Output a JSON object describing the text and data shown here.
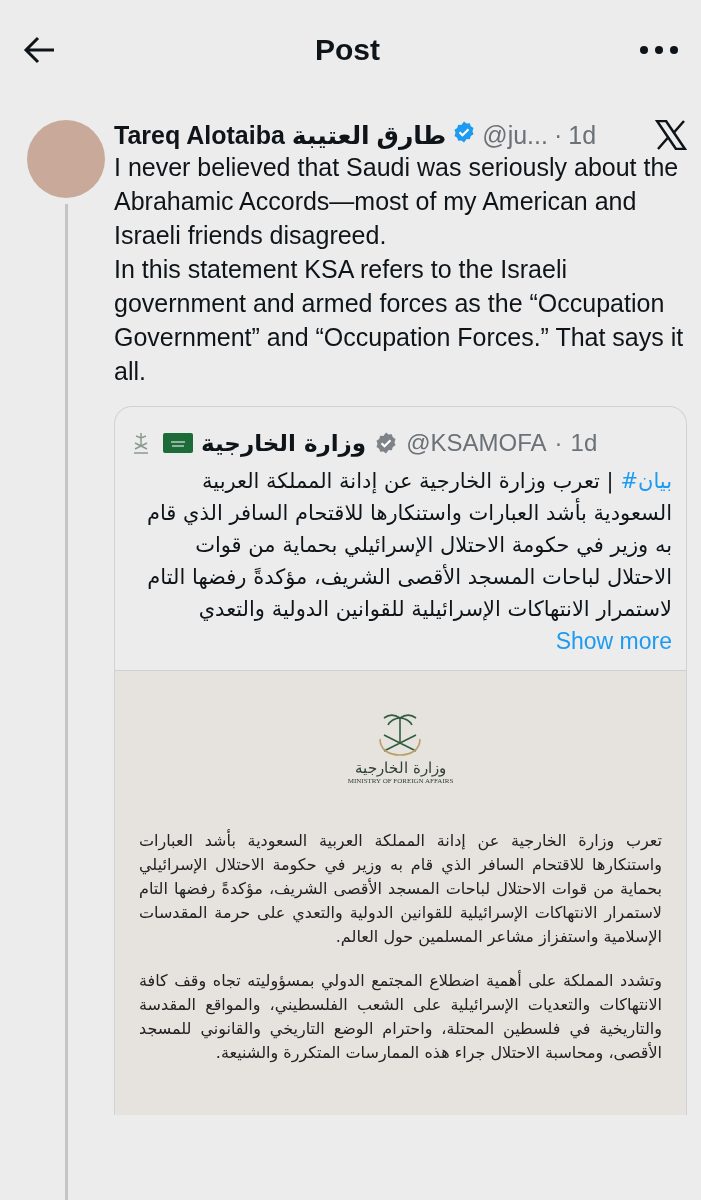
{
  "header": {
    "title": "Post"
  },
  "post": {
    "author_name": "Tareq Alotaiba طارق العتيبة",
    "verified": true,
    "handle": "@ju...",
    "separator": "·",
    "time": "1d",
    "paragraphs": [
      "I never believed that Saudi was seriously about the Abrahamic Accords—most of my American and Israeli friends disagreed.",
      "In this statement KSA refers to the Israeli government and armed forces as the “Occupation Government” and “Occupation Forces.” That says it all."
    ]
  },
  "quote": {
    "author_name": "وزارة الخارجية",
    "verified": true,
    "handle": "@KSAMOFA",
    "separator": "·",
    "time": "1d",
    "hashtag": "#بيان",
    "text": " | تعرب وزارة الخارجية عن إدانة المملكة العربية السعودية بأشد العبارات واستنكارها للاقتحام السافر الذي قام به وزير في حكومة الاحتلال الإسرائيلي بحماية من قوات الاحتلال لباحات المسجد الأقصى الشريف، مؤكدةً رفضها التام لاستمرار الانتهاكات الإسرائيلية للقوانين الدولية والتعدي ",
    "show_more": "Show more",
    "attachment": {
      "kind": "document",
      "emblem_caption": "وزارة الخارجية",
      "emblem_subtitle": "MINISTRY OF FOREIGN AFFAIRS",
      "paragraphs": [
        "تعرب وزارة الخارجية عن إدانة المملكة العربية السعودية بأشد العبارات واستنكارها للاقتحام السافر الذي قام به وزير في حكومة الاحتلال الإسرائيلي بحماية من قوات الاحتلال لباحات المسجد الأقصى الشريف، مؤكدةً رفضها التام لاستمرار الانتهاكات الإسرائيلية للقوانين الدولية والتعدي على حرمة المقدسات الإسلامية واستفزاز مشاعر المسلمين حول العالم.",
        "وتشدد المملكة على أهمية اضطلاع المجتمع الدولي بمسؤوليته تجاه وقف كافة الانتهاكات والتعديات الإسرائيلية على الشعب الفلسطيني، والمواقع المقدسة والتاريخية في فلسطين المحتلة، واحترام الوضع التاريخي والقانوني للمسجد الأقصى، ومحاسبة الاحتلال جراء هذه الممارسات المتكررة والشنيعة."
      ]
    }
  }
}
